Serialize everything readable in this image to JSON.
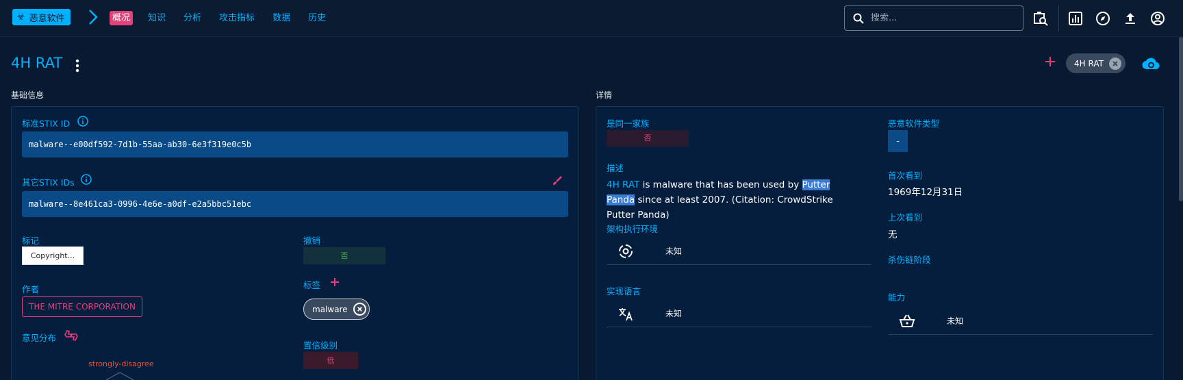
{
  "brand": {
    "label": "恶意软件"
  },
  "nav": {
    "items": [
      "概况",
      "知识",
      "分析",
      "攻击指标",
      "数据",
      "历史"
    ]
  },
  "search": {
    "placeholder": "搜索..."
  },
  "entity": {
    "title": "4H RAT",
    "top_chip": "4H RAT"
  },
  "sections": {
    "basic": "基础信息",
    "details": "详情"
  },
  "basic": {
    "stix_id_label": "标准STIX ID",
    "stix_id": "malware--e00df592-7d1b-55aa-ab30-6e3f319e0c5b",
    "other_ids_label": "其它STIX IDs",
    "other_id": "malware--8e461ca3-0996-4e6e-a0df-e2a5bbc51ebc",
    "marking_label": "标记",
    "marking": "Copyright...",
    "revoked_label": "撤销",
    "revoked": "否",
    "author_label": "作者",
    "author": "THE MITRE CORPORATION",
    "labels_label": "标签",
    "tag": "malware",
    "opinion_label": "意见分布",
    "opinion_value": "strongly-disagree",
    "confidence_label": "置信级别",
    "confidence": "低"
  },
  "details": {
    "family_label": "是同一家族",
    "family": "否",
    "description_label": "描述",
    "desc_link": "4H RAT",
    "desc_mid": " is malware that has been used by ",
    "desc_highlight": "Putter Panda",
    "desc_rest": " since at least 2007. (Citation: CrowdStrike Putter Panda)",
    "arch_label": "架构执行环境",
    "arch_value": "未知",
    "lang_label": "实现语言",
    "lang_value": "未知",
    "type_label": "恶意软件类型",
    "type_value": "-",
    "first_seen_label": "首次看到",
    "first_seen": "1969年12月31日",
    "last_seen_label": "上次看到",
    "last_seen": "无",
    "kill_chain_label": "杀伤链阶段",
    "capabilities_label": "能力",
    "capabilities_value": "未知"
  },
  "colors": {
    "accent": "#00b1ff",
    "pink": "#e83e7a",
    "background": "#071a31",
    "panel": "#061e3d",
    "field": "#0a4a86"
  },
  "icons": [
    "biohazard-icon",
    "chevron-right-icon",
    "search-icon",
    "investigate-icon",
    "chart-icon",
    "compass-icon",
    "upload-icon",
    "account-icon",
    "more-vert-icon",
    "plus-icon",
    "cancel-icon",
    "cloud-refresh-icon",
    "info-icon",
    "brush-icon",
    "thumbs-icon",
    "settings-gear-icon",
    "translate-icon",
    "basket-icon"
  ]
}
